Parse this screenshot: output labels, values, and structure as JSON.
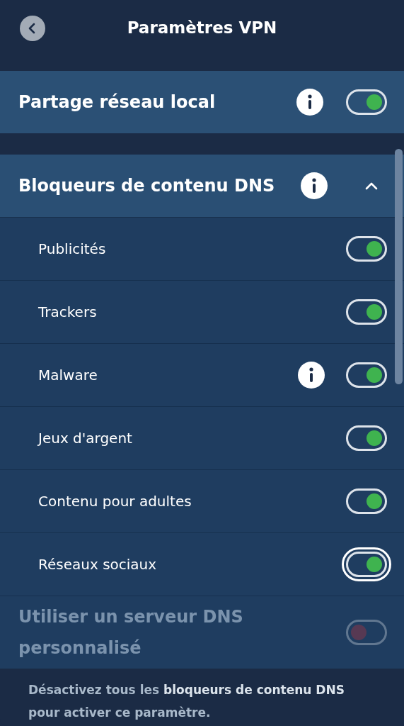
{
  "header": {
    "title": "Paramètres VPN"
  },
  "local_sharing": {
    "label": "Partage réseau local",
    "info": true,
    "on": true
  },
  "dns_blockers": {
    "label": "Bloqueurs de contenu DNS",
    "info": true,
    "expanded": true,
    "items": [
      {
        "label": "Publicités",
        "info": false,
        "on": true,
        "focused": false
      },
      {
        "label": "Trackers",
        "info": false,
        "on": true,
        "focused": false
      },
      {
        "label": "Malware",
        "info": true,
        "on": true,
        "focused": false
      },
      {
        "label": "Jeux d'argent",
        "info": false,
        "on": true,
        "focused": false
      },
      {
        "label": "Contenu pour adultes",
        "info": false,
        "on": true,
        "focused": false
      },
      {
        "label": "Réseaux sociaux",
        "info": false,
        "on": true,
        "focused": true
      }
    ]
  },
  "custom_dns": {
    "label": "Utiliser un serveur DNS personnalisé",
    "on": false,
    "disabled": true
  },
  "note": "Désactivez tous les **bloqueurs de contenu DNS** pour activer ce paramètre."
}
